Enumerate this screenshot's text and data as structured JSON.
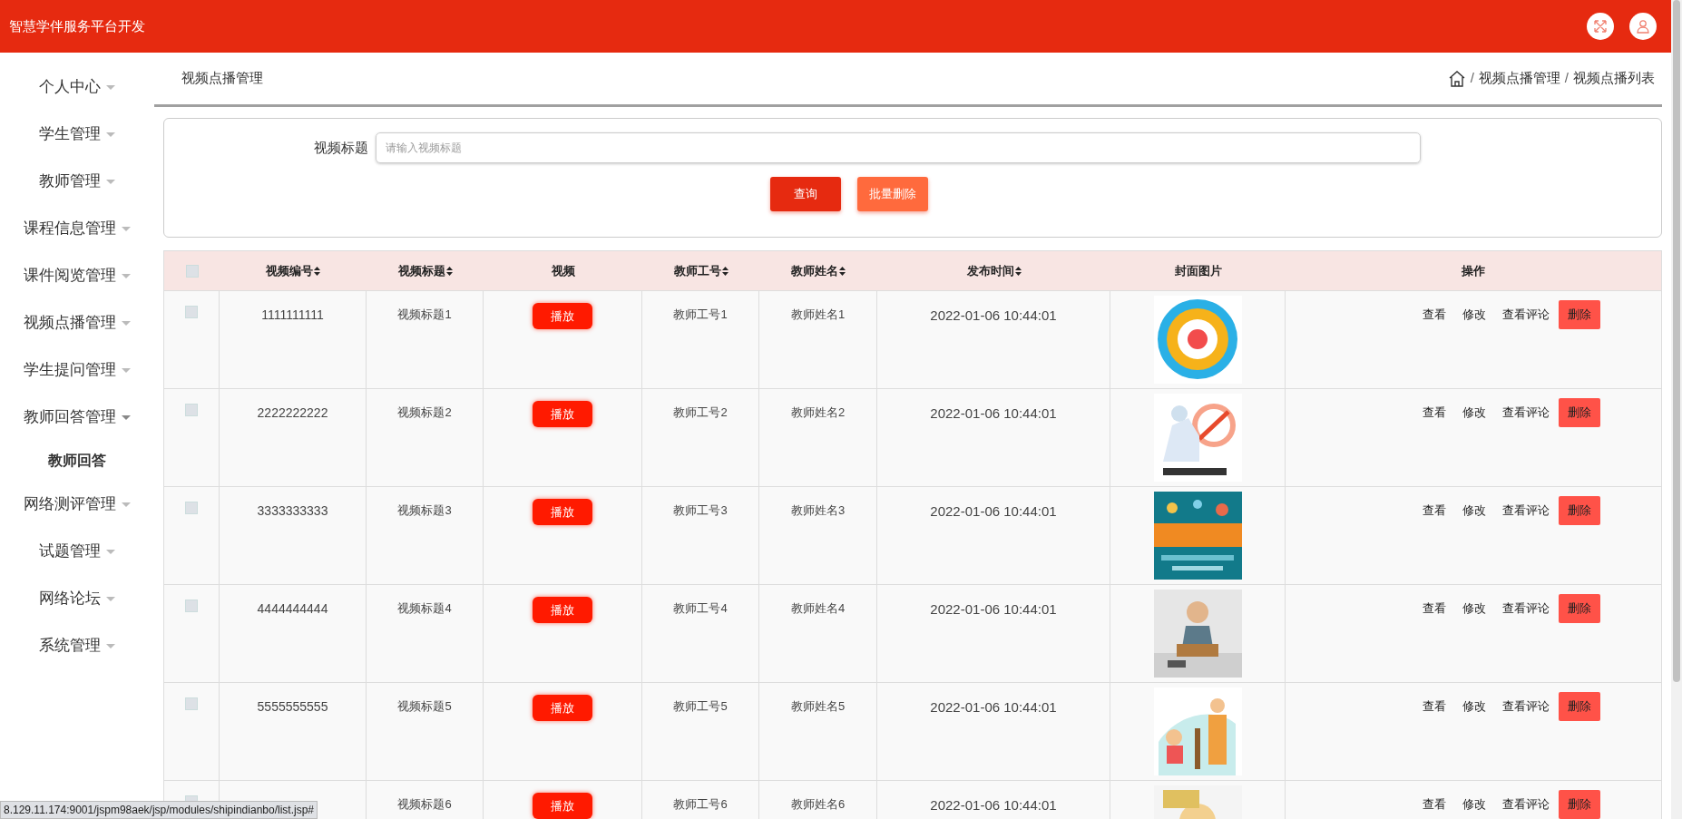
{
  "header": {
    "title": "智慧学伴服务平台开发"
  },
  "sidebar": {
    "items": [
      {
        "label": "个人中心",
        "expanded": false
      },
      {
        "label": "学生管理",
        "expanded": false
      },
      {
        "label": "教师管理",
        "expanded": false
      },
      {
        "label": "课程信息管理",
        "expanded": false
      },
      {
        "label": "课件阅览管理",
        "expanded": false
      },
      {
        "label": "视频点播管理",
        "expanded": false
      },
      {
        "label": "学生提问管理",
        "expanded": false
      },
      {
        "label": "教师回答管理",
        "expanded": true,
        "children": [
          {
            "label": "教师回答"
          }
        ]
      },
      {
        "label": "网络测评管理",
        "expanded": false
      },
      {
        "label": "试题管理",
        "expanded": false
      },
      {
        "label": "网络论坛",
        "expanded": false
      },
      {
        "label": "系统管理",
        "expanded": false
      }
    ]
  },
  "page_title": "视频点播管理",
  "breadcrumb": [
    {
      "separator": "/",
      "label": "视频点播管理"
    },
    {
      "separator": "/",
      "label": "视频点播列表"
    }
  ],
  "search": {
    "label": "视频标题",
    "placeholder": "请输入视频标题",
    "buttons": [
      "查询",
      "批量删除"
    ]
  },
  "table": {
    "select_all_checked": false,
    "columns": [
      {
        "label": "视频编号",
        "sortable": true
      },
      {
        "label": "视频标题",
        "sortable": true
      },
      {
        "label": "视频",
        "sortable": false
      },
      {
        "label": "教师工号",
        "sortable": true
      },
      {
        "label": "教师姓名",
        "sortable": true
      },
      {
        "label": "发布时间",
        "sortable": true
      },
      {
        "label": "封面图片",
        "sortable": false
      },
      {
        "label": "操作",
        "sortable": false
      }
    ],
    "rows": [
      {
        "checked": false,
        "id": "1111111111",
        "title": "视频标题1",
        "play": "播放",
        "teacher_no": "教师工号1",
        "teacher_name": "教师姓名1",
        "time": "2022-01-06 10:44:01",
        "actions": [
          "查看",
          "修改",
          "查看评论",
          "删除"
        ]
      },
      {
        "checked": false,
        "id": "2222222222",
        "title": "视频标题2",
        "play": "播放",
        "teacher_no": "教师工号2",
        "teacher_name": "教师姓名2",
        "time": "2022-01-06 10:44:01",
        "actions": [
          "查看",
          "修改",
          "查看评论",
          "删除"
        ]
      },
      {
        "checked": false,
        "id": "3333333333",
        "title": "视频标题3",
        "play": "播放",
        "teacher_no": "教师工号3",
        "teacher_name": "教师姓名3",
        "time": "2022-01-06 10:44:01",
        "actions": [
          "查看",
          "修改",
          "查看评论",
          "删除"
        ]
      },
      {
        "checked": false,
        "id": "4444444444",
        "title": "视频标题4",
        "play": "播放",
        "teacher_no": "教师工号4",
        "teacher_name": "教师姓名4",
        "time": "2022-01-06 10:44:01",
        "actions": [
          "查看",
          "修改",
          "查看评论",
          "删除"
        ]
      },
      {
        "checked": false,
        "id": "5555555555",
        "title": "视频标题5",
        "play": "播放",
        "teacher_no": "教师工号5",
        "teacher_name": "教师姓名5",
        "time": "2022-01-06 10:44:01",
        "actions": [
          "查看",
          "修改",
          "查看评论",
          "删除"
        ]
      },
      {
        "checked": false,
        "title": "视频标题6",
        "play": "播放",
        "teacher_no": "教师工号6",
        "teacher_name": "教师姓名6",
        "time": "2022-01-06 10:44:01",
        "actions": [
          "查看",
          "修改",
          "查看评论",
          "删除"
        ]
      }
    ]
  },
  "status_url": "8.129.11.174:9001/jspm98aek/jsp/modules/shipindianbo/list.jsp#"
}
